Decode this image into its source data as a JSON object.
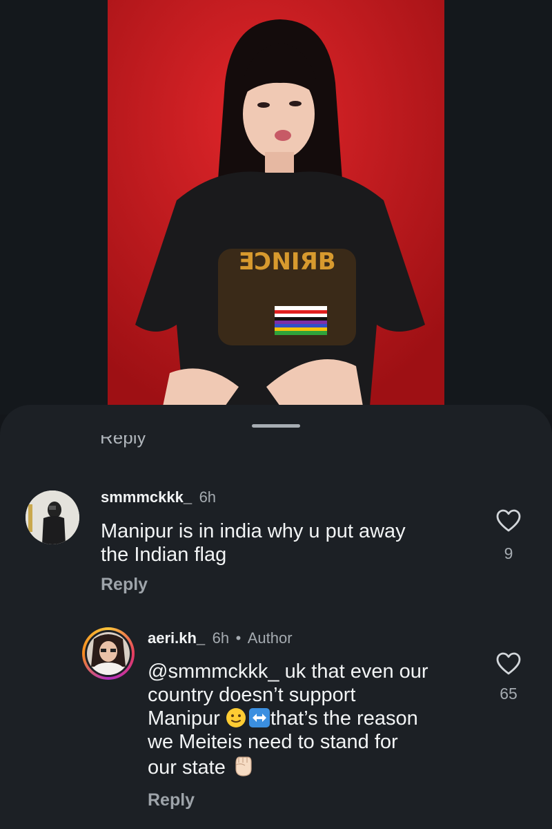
{
  "hidden_reply_label": "Reply",
  "comments": [
    {
      "username": "smmmckkk_",
      "time": "6h",
      "text_line1": "Manipur is in india why u put away",
      "text_line2": "the Indian flag",
      "reply_label": "Reply",
      "likes": "9"
    },
    {
      "username": "aeri.kh_",
      "time": "6h",
      "separator": "•",
      "badge": "Author",
      "mention": "@smmmckkk_",
      "text_line1_rest": " uk that even our",
      "text_line2": "country doesn’t support",
      "text_line3_a": "Manipur ",
      "text_line3_b": "that’s the reason",
      "text_line4": "we Meiteis need to stand for",
      "text_line5": "our state ",
      "reply_label": "Reply",
      "likes": "65"
    }
  ],
  "icons": {
    "like": "heart-outline-icon",
    "emoji_smile": "slightly-smiling-face-emoji",
    "emoji_arrow": "left-right-arrow-emoji",
    "emoji_fist": "raised-fist-emoji"
  },
  "colors": {
    "video_background": "#c8181c",
    "sheet_background": "#1c2025",
    "page_background": "#13161a"
  }
}
